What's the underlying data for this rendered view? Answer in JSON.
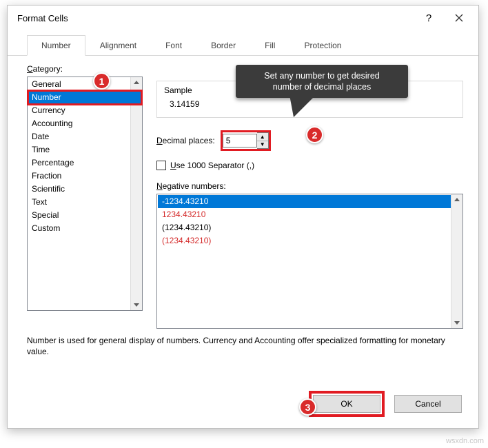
{
  "title": "Format Cells",
  "tabs": [
    "Number",
    "Alignment",
    "Font",
    "Border",
    "Fill",
    "Protection"
  ],
  "category_label_pre": "C",
  "category_label_rest": "ategory:",
  "categories": [
    "General",
    "Number",
    "Currency",
    "Accounting",
    "Date",
    "Time",
    "Percentage",
    "Fraction",
    "Scientific",
    "Text",
    "Special",
    "Custom"
  ],
  "sample_label": "Sample",
  "sample_value": "3.14159",
  "decimal_label_pre": "D",
  "decimal_label_rest": "ecimal places:",
  "decimal_value": "5",
  "separator_label_pre": "U",
  "separator_label_rest": "se 1000 Separator (,)",
  "neg_label_pre": "N",
  "neg_label_rest": "egative numbers:",
  "neg_items": [
    {
      "text": "-1234.43210",
      "red": false,
      "sel": true
    },
    {
      "text": "1234.43210",
      "red": true,
      "sel": false
    },
    {
      "text": "(1234.43210)",
      "red": false,
      "sel": false
    },
    {
      "text": "(1234.43210)",
      "red": true,
      "sel": false
    }
  ],
  "description": "Number is used for general display of numbers.  Currency and Accounting offer specialized formatting for monetary value.",
  "ok_label": "OK",
  "cancel_label": "Cancel",
  "tooltip_line1": "Set any number to get desired",
  "tooltip_line2": "number of decimal places",
  "badges": {
    "b1": "1",
    "b2": "2",
    "b3": "3"
  },
  "watermark": "wsxdn.com"
}
